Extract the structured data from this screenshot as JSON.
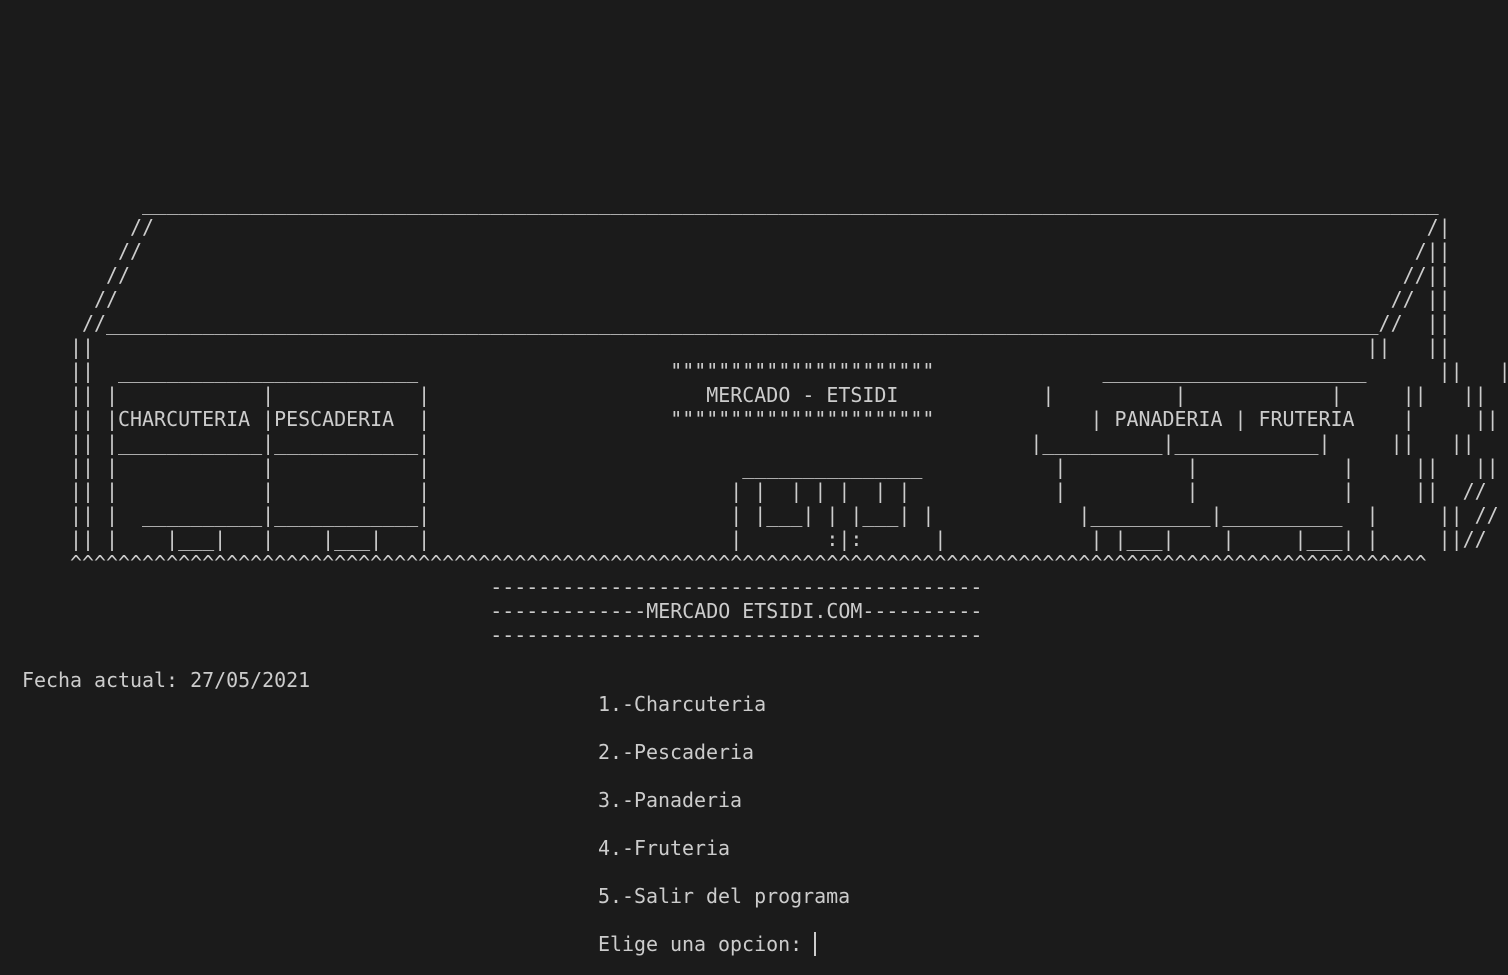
{
  "terminal": {
    "banner": [
      "           ____________________________________________________________________________________________________________",
      "          //                                                                                                          /|",
      "         //                                                                                                          /||",
      "        //                                                                                                          //||",
      "       //                                                                                                          // ||",
      "      //__________________________________________________________________________________________________________//  ||",
      "     ||                                                                                                          ||   ||",
      "     ||  _________________________                     \"\"\"\"\"\"\"\"\"\"\"\"\"\"\"\"\"\"\"\"\"\"              ______________________      ||   ||",
      "     || |            |            |                       MERCADO - ETSIDI            |          |            |     ||   ||",
      "     || |CHARCUTERIA |PESCADERIA  |                    \"\"\"\"\"\"\"\"\"\"\"\"\"\"\"\"\"\"\"\"\"\"             | PANADERIA | FRUTERIA    |     ||   ||",
      "     || |____________|____________|                                                  |__________|____________|     ||   ||",
      "     || |            |            |                          _______________           |          |            |     ||   ||",
      "     || |            |            |                         | |  | | |  | |            |          |            |     ||  //",
      "     || |  __________|____________|                         | |___| | |___| |            |__________|__________  |     || //",
      "     || |    |___|   |    |___|   |                         |       :|:      |            | |___|    |     |___| |     ||//",
      "     ^^^^^^^^^^^^^^^^^^^^^^^^^^^^^^^^^^^^^^^^^^^^^^^^^^^^^^^^^^^^^^^^^^^^^^^^^^^^^^^^^^^^^^^^^^^^^^^^^^^^^^^^^^^^^^^^^",
      "                                        -----------------------------------------",
      "                                        -------------MERCADO ETSIDI.COM----------",
      "                                        -----------------------------------------"
    ],
    "date_line": "Fecha actual: 27/05/2021",
    "menu": {
      "option1": "1.-Charcuteria",
      "option2": "2.-Pescaderia",
      "option3": "3.-Panaderia",
      "option4": "4.-Fruteria",
      "option5": "5.-Salir del programa",
      "prompt": "Elige una opcion: "
    }
  }
}
